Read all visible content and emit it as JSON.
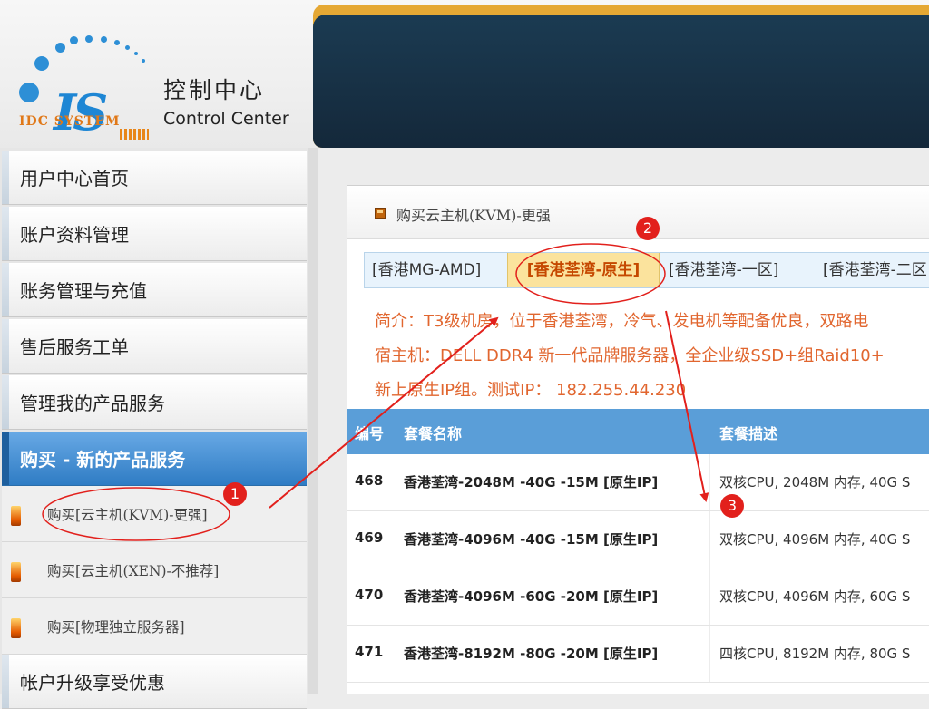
{
  "logo": {
    "brand_art": "IS",
    "caption": "IDC SYSTEM",
    "title_cn": "控制中心",
    "title_en": "Control Center"
  },
  "sidebar": {
    "items": [
      {
        "label": "用户中心首页"
      },
      {
        "label": "账户资料管理"
      },
      {
        "label": "账务管理与充值"
      },
      {
        "label": "售后服务工单"
      },
      {
        "label": "管理我的产品服务"
      },
      {
        "label": "购买 - 新的产品服务",
        "active": true
      }
    ],
    "sub_items": [
      {
        "label": "购买[云主机(KVM)-更强]",
        "icon": "server-icon"
      },
      {
        "label": "购买[云主机(XEN)-不推荐]",
        "icon": "server-icon"
      },
      {
        "label": "购买[物理独立服务器]",
        "icon": "server-icon"
      }
    ],
    "bottom_item": {
      "label": "帐户升级享受优惠"
    }
  },
  "panel": {
    "title": "购买云主机(KVM)-更强",
    "tabs": [
      {
        "label": "[香港MG-AMD]"
      },
      {
        "label": "[香港荃湾-原生]",
        "selected": true
      },
      {
        "label": "[香港荃湾-一区]"
      },
      {
        "label": "[香港荃湾-二区"
      }
    ],
    "intro": [
      "简介：T3级机房，位于香港荃湾，冷气、发电机等配备优良，双路电",
      "宿主机：DELL DDR4 新一代品牌服务器，全企业级SSD+组Raid10+",
      "新上原生IP组。测试IP： 182.255.44.230"
    ]
  },
  "table": {
    "headers": {
      "id": "编号",
      "name": "套餐名称",
      "desc": "套餐描述"
    },
    "rows": [
      {
        "id": "468",
        "name": "香港荃湾-2048M -40G -15M [原生IP]",
        "desc": "双核CPU, 2048M 内存, 40G S"
      },
      {
        "id": "469",
        "name": "香港荃湾-4096M -40G -15M [原生IP]",
        "desc": "双核CPU, 4096M 内存, 40G S"
      },
      {
        "id": "470",
        "name": "香港荃湾-4096M -60G -20M [原生IP]",
        "desc": "双核CPU, 4096M 内存, 60G S"
      },
      {
        "id": "471",
        "name": "香港荃湾-8192M -80G -20M [原生IP]",
        "desc": "四核CPU, 8192M 内存, 80G S"
      }
    ]
  },
  "annotations": {
    "badges": [
      "1",
      "2",
      "3"
    ],
    "color": "#e2201c"
  },
  "colors": {
    "accent_blue": "#3b86cf",
    "banner_gold": "#e5a834",
    "banner_navy": "#1b3b52",
    "intro_orange": "#e1662f",
    "selected_tab": "#fbe39d"
  }
}
